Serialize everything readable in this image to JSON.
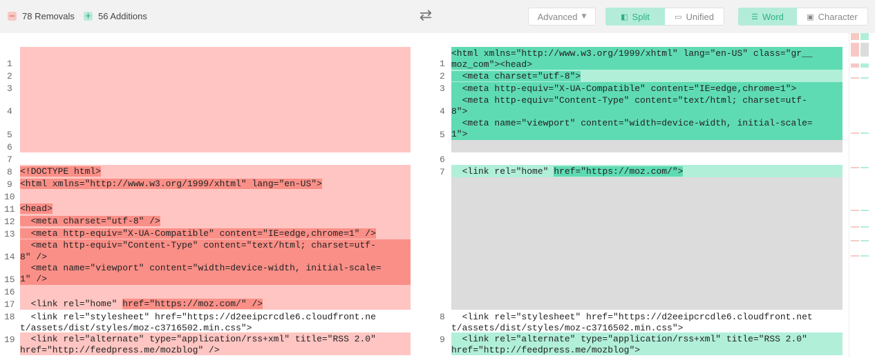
{
  "toolbar": {
    "removals_icon": "minus-icon",
    "removals": "78 Removals",
    "additions_icon": "plus-icon",
    "additions": "56 Additions",
    "swap_icon": "swap-arrows-icon",
    "advanced_label": "Advanced",
    "split_label": "Split",
    "unified_label": "Unified",
    "word_label": "Word",
    "character_label": "Character"
  },
  "colors": {
    "removed_line": "#ffc5c2",
    "removed_word": "#fa8f87",
    "added_line": "#b1efd9",
    "added_word": "#5fdbb3",
    "placeholder": "#dcdcdc",
    "accent": "#2bb286"
  },
  "left": {
    "nums": [
      "1",
      "2",
      "3",
      "4",
      "5",
      "6",
      "7",
      "8",
      "9",
      "10",
      "11",
      "12",
      "13",
      "14",
      "15",
      "16",
      "17",
      "18",
      "19"
    ],
    "code": {
      "l8": "<!DOCTYPE html>",
      "l9": "<html xmlns=\"http://www.w3.org/1999/xhtml\" lang=\"en-US\">",
      "l11": "<head>",
      "l12": "  <meta charset=\"utf-8\" />",
      "l13": "  <meta http-equiv=\"X-UA-Compatible\" content=\"IE=edge,chrome=1\" />",
      "l14a": "  <meta http-equiv=\"Content-Type\" content=\"text/html; charset=utf-",
      "l14b": "8\" />",
      "l15a": "  <meta name=\"viewport\" content=\"width=device-width, initial-scale=",
      "l15b": "1\" />",
      "l17a": "  <link rel=\"home\" ",
      "l17b": "href=\"https://moz.com/\" />",
      "l18a": "  <link rel=\"stylesheet\" href=\"https://d2eeipcrcdle6.cloudfront.ne",
      "l18b": "t/assets/dist/styles/moz-c3716502.min.css\">",
      "l19a": "  <link rel=\"alternate\" type=\"application/rss+xml\" title=\"RSS 2.0\"",
      "l19b": "href=\"http://feedpress.me/mozblog\" />"
    }
  },
  "right": {
    "nums": [
      "1",
      "2",
      "3",
      "4",
      "5",
      "6",
      "7",
      "8",
      "9"
    ],
    "code": {
      "l1a": "<html xmlns=\"http://www.w3.org/1999/xhtml\" lang=\"en-US\" class=\"gr__",
      "l1b": "moz_com\"><head>",
      "l2": "  <meta charset=\"utf-8\">",
      "l3": "  <meta http-equiv=\"X-UA-Compatible\" content=\"IE=edge,chrome=1\">",
      "l4a": "  <meta http-equiv=\"Content-Type\" content=\"text/html; charset=utf-",
      "l4b": "8\">",
      "l5a": "  <meta name=\"viewport\" content=\"width=device-width, initial-scale=",
      "l5b": "1\">",
      "l7a": "  <link rel=\"home\" ",
      "l7b": "href=\"https://moz.com/\">",
      "l8a": "  <link rel=\"stylesheet\" href=\"https://d2eeipcrcdle6.cloudfront.net",
      "l8b": "t/assets/dist/styles/moz-c3716502.min.css\">",
      "l9a": "  <link rel=\"alternate\" type=\"application/rss+xml\" title=\"RSS 2.0\"",
      "l9b": "href=\"http://feedpress.me/mozblog\">"
    }
  }
}
